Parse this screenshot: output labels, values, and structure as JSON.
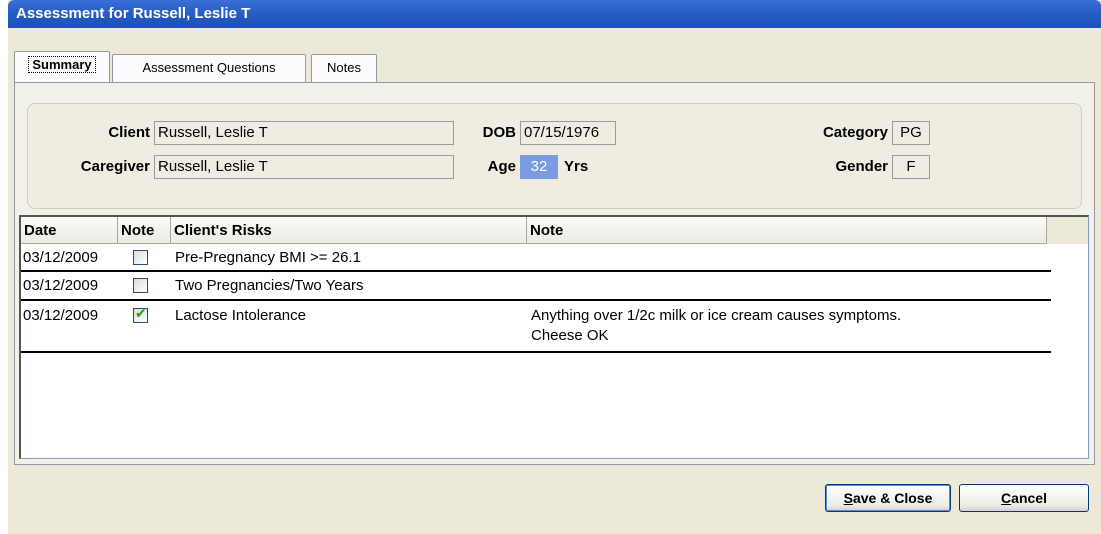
{
  "window": {
    "title": "Assessment for Russell, Leslie T"
  },
  "tabs": [
    {
      "label": "Summary"
    },
    {
      "label": "Assessment Questions"
    },
    {
      "label": "Notes"
    }
  ],
  "client_info": {
    "client_label": "Client",
    "client_value": "Russell, Leslie T",
    "caregiver_label": "Caregiver",
    "caregiver_value": "Russell, Leslie T",
    "dob_label": "DOB",
    "dob_value": "07/15/1976",
    "age_label": "Age",
    "age_value": "32",
    "age_unit": "Yrs",
    "category_label": "Category",
    "category_value": "PG",
    "gender_label": "Gender",
    "gender_value": "F"
  },
  "risk_grid": {
    "headers": [
      "Date",
      "Note",
      "Client's Risks",
      "Note"
    ],
    "rows": [
      {
        "date": "03/12/2009",
        "note_checked": false,
        "risk": "Pre-Pregnancy BMI >= 26.1",
        "note_line1": "",
        "note_line2": ""
      },
      {
        "date": "03/12/2009",
        "note_checked": false,
        "risk": "Two Pregnancies/Two Years",
        "note_line1": "",
        "note_line2": ""
      },
      {
        "date": "03/12/2009",
        "note_checked": true,
        "risk": "Lactose Intolerance",
        "note_line1": "Anything over 1/2c milk or ice cream causes symptoms.",
        "note_line2": "Cheese OK"
      }
    ]
  },
  "buttons": {
    "save_underline": "S",
    "save_rest": "ave & Close",
    "cancel_underline": "C",
    "cancel_rest": "ancel"
  },
  "colors": {
    "titlebar": "#2a5fc8",
    "age_highlight": "#7B9BE0",
    "check_mark": "#21A121"
  }
}
